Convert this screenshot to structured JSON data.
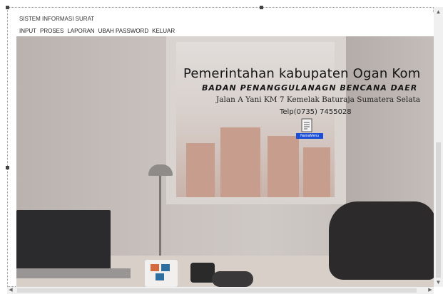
{
  "window": {
    "title": "SISTEM INFORMASI SURAT"
  },
  "menu": [
    {
      "label": "INPUT"
    },
    {
      "label": "PROSES"
    },
    {
      "label": "LAPORAN"
    },
    {
      "label": "UBAH PASSWORD"
    },
    {
      "label": "KELUAR"
    }
  ],
  "header": {
    "title": "Pemerintahan kabupaten Ogan Kom",
    "subtitle": "BADAN PENANGGULANAGN BENCANA DAER",
    "address": "Jalan A Yani KM 7 Kemelak Baturaja Sumatera Selata",
    "telephone": "Telp(0735) 7455028"
  },
  "desktop_icon": {
    "name": "document-icon",
    "caption": "NamaMenu"
  },
  "colors": {
    "selection": "#1b4fd8",
    "text": "#151515"
  }
}
